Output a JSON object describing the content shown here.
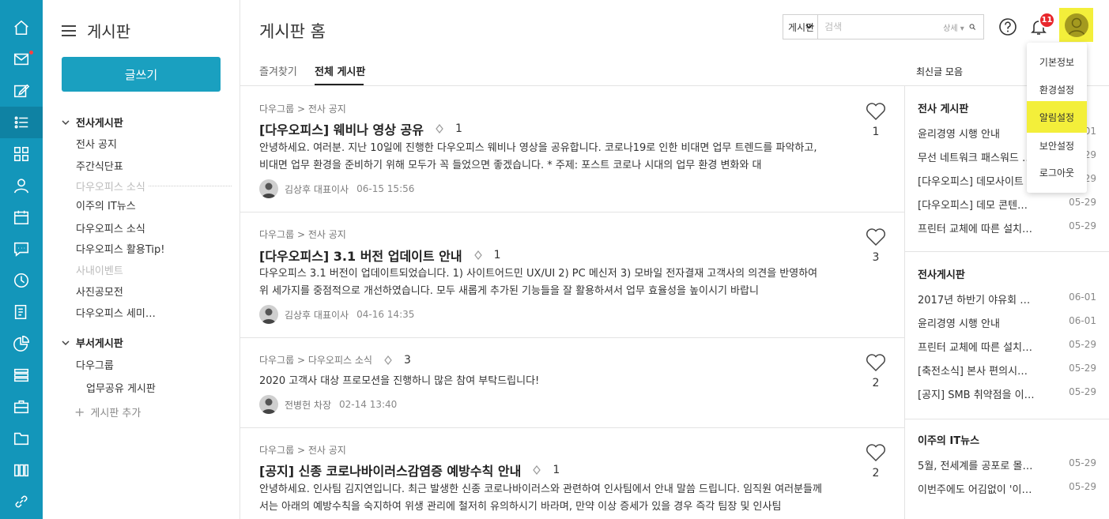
{
  "colors": {
    "rail": "#1396ba",
    "accent": "#1aa0c0",
    "highlight": "#f3ef3a",
    "badge": "#e8272c"
  },
  "rail": {
    "icons": [
      "home-icon",
      "mail-icon",
      "edit-icon",
      "board-list-icon",
      "apps-icon",
      "person-icon",
      "calendar-icon",
      "chat-icon",
      "clock-icon",
      "report-icon",
      "chart-icon",
      "list-icon",
      "briefcase-icon",
      "folder-icon",
      "building-icon",
      "link-icon"
    ]
  },
  "nav": {
    "title": "게시판",
    "write_button": "글쓰기",
    "groups": [
      {
        "label": "전사게시판"
      },
      {
        "label": "부서게시판"
      }
    ],
    "items": [
      "전사 공지",
      "주간식단표",
      "이주의 IT뉴스",
      "다우오피스 소식",
      "다우오피스 활용Tip!",
      "사진공모전",
      "다우오피스 세미…",
      "다우그룹",
      "업무공유 게시판"
    ],
    "separators": [
      "다우오피스 소식",
      "사내이벤트"
    ],
    "add_board": "게시판 추가"
  },
  "main": {
    "title": "게시판 홈",
    "tabs": [
      "즐겨찾기",
      "전체 게시판"
    ],
    "latest_label": "최신글 모음"
  },
  "search": {
    "scope": "게시판",
    "placeholder": "검색",
    "detail": "상세"
  },
  "header": {
    "notification_count": "11"
  },
  "posts": [
    {
      "crumb": "다우그룹 > 전사 공지",
      "title": "[다우오피스] 웨비나 영상 공유",
      "comments": "1",
      "body": "      안녕하세요. 여러분. 지난 10일에 진행한 다우오피스 웨비나 영상을 공유합니다.   코로나19로 인한 비대면 업무 트렌드를 파악하고, 비대면 업무 환경을 준비하기 위해 모두가 꼭 들었으면 좋겠습니다.      * 주제: 포스트 코로나 시대의 업무 환경 변화와 대",
      "author": "김상후 대표이사",
      "time": "06-15 15:56",
      "likes": "1"
    },
    {
      "crumb": "다우그룹 > 전사 공지",
      "title": "[다우오피스] 3.1 버전 업데이트 안내",
      "comments": "1",
      "body": "다우오피스 3.1 버전이 업데이트되었습니다.       1) 사이트어드민 UX/UI 2) PC 메신저 3) 모바일 전자결재     고객사의 의견을 반영하여 위 세가지를 중점적으로 개선하였습니다. 모두 새롭게 추가된 기능들을 잘 활용하셔서 업무 효율성을 높이시기 바랍니",
      "author": "김상후 대표이사",
      "time": "04-16 14:35",
      "likes": "3"
    },
    {
      "crumb": "다우그룹 > 다우오피스 소식",
      "title": "",
      "comments": "3",
      "body": "2020 고객사 대상 프로모션을 진행하니 많은 참여 부탁드립니다!",
      "author": "전병헌 차장",
      "time": "02-14 13:40",
      "likes": "2"
    },
    {
      "crumb": "다우그룹 > 전사 공지",
      "title": "[공지] 신종 코로나바이러스감염증 예방수칙 안내",
      "comments": "1",
      "body": "안녕하세요. 인사팀 김지연입니다. 최근 발생한 신종 코로나바이러스와 관련하여 인사팀에서 안내 말씀 드립니다.   임직원 여러분들께서는 아래의 예방수칙을 숙지하여 위생 관리에 철저히 유의하시기 바라며, 만약 이상 증세가 있을 경우 즉각 팀장 및 인사팀",
      "author": "",
      "time": "",
      "likes": "2"
    }
  ],
  "latest": [
    {
      "title": "전사 게시판",
      "rows": [
        {
          "t": "윤리경영 시행 안내",
          "d": "06-01"
        },
        {
          "t": "무선 네트워크 패스워드 …",
          "d": "05-29"
        },
        {
          "t": "[다우오피스] 데모사이트 …",
          "d": "05-29"
        },
        {
          "t": "[다우오피스] 데모 콘텐…",
          "d": "05-29"
        },
        {
          "t": "프린터 교체에 따른 설치…",
          "d": "05-29"
        }
      ]
    },
    {
      "title": "전사게시판",
      "rows": [
        {
          "t": "2017년 하반기 야유회 …",
          "d": "06-01"
        },
        {
          "t": "윤리경영 시행 안내",
          "d": "06-01"
        },
        {
          "t": "프린터 교체에 따른 설치…",
          "d": "05-29"
        },
        {
          "t": "[축전소식] 본사 편의시…",
          "d": "05-29"
        },
        {
          "t": "[공지] SMB 취약점을 이…",
          "d": "05-29"
        }
      ]
    },
    {
      "title": "이주의 IT뉴스",
      "rows": [
        {
          "t": "5월, 전세계를 공포로 몰…",
          "d": "05-29"
        },
        {
          "t": "이번주에도 어김없이 '이…",
          "d": "05-29"
        }
      ]
    }
  ],
  "profile_menu": [
    "기본정보",
    "환경설정",
    "알림설정",
    "보안설정",
    "로그아웃"
  ]
}
